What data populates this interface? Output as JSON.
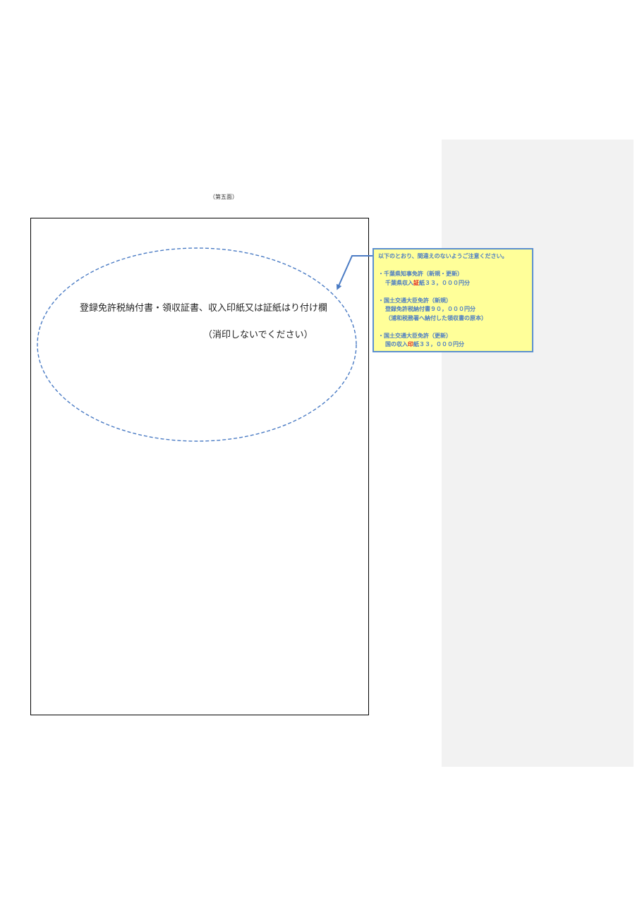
{
  "page": {
    "number_label": "（第五面）"
  },
  "stamp_area": {
    "title": "登録免許税納付書・領収証書、収入印紙又は証紙はり付け欄",
    "note": "（消印しないでください）"
  },
  "callout": {
    "heading": "以下のとおり、間違えのないようご注意ください。",
    "items": [
      {
        "label": "・千葉県知事免許（新規・更新）",
        "detail_pre": "千葉県収入",
        "detail_highlight": "証",
        "detail_post": "紙３３，０００円分"
      },
      {
        "label": "・国土交通大臣免許（新規）",
        "detail": "登録免許税納付書９０，０００円分",
        "sub_detail": "（浦和税務署へ納付した領収書の原本）"
      },
      {
        "label": "・国土交通大臣免許（更新）",
        "detail_pre": "国の収入",
        "detail_highlight": "印",
        "detail_post": "紙３３，０００円分"
      }
    ]
  },
  "colors": {
    "callout_background": "#ffff99",
    "callout_border": "#5b8fd0",
    "callout_text": "#4a7bc4",
    "highlight": "#e02020",
    "comment_pane": "#f2f2f2",
    "ellipse_stroke": "#4a7bc4"
  }
}
